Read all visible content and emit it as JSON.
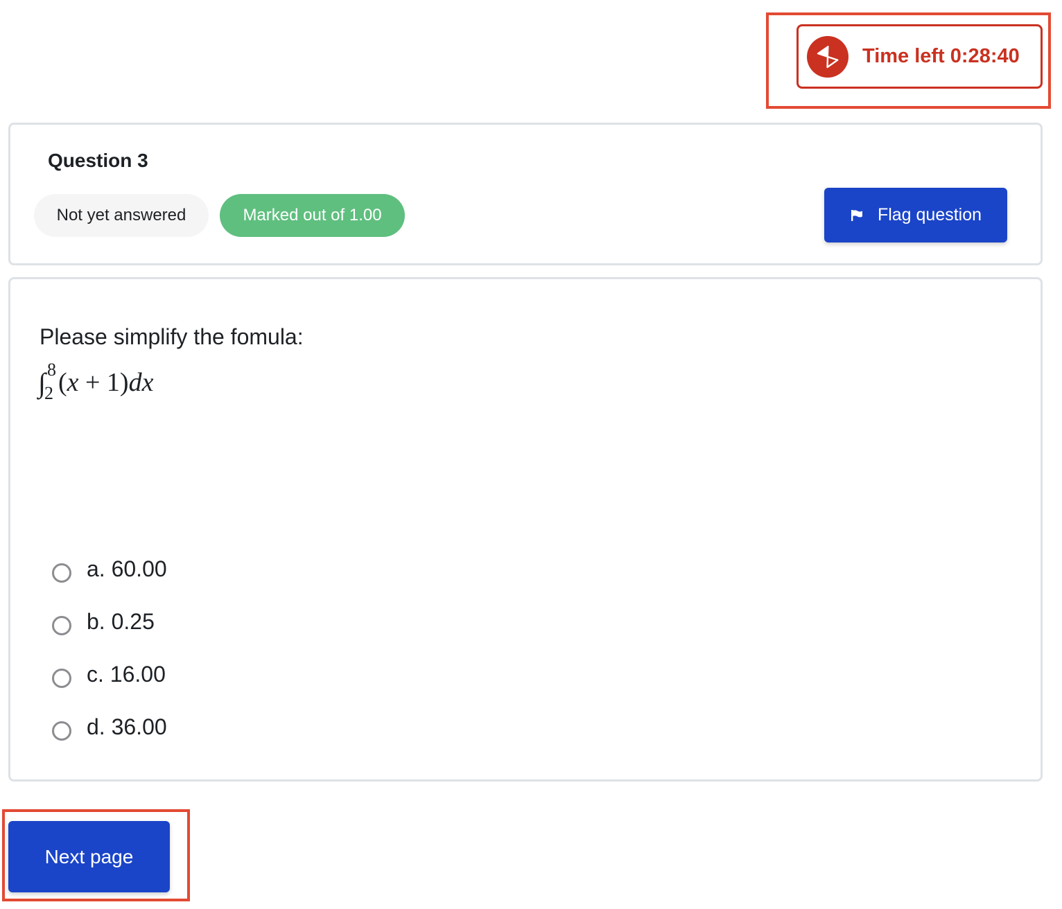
{
  "timer": {
    "label": "Time left 0:28:40",
    "icon": "hourglass-icon",
    "color": "#ca3120"
  },
  "question": {
    "title": "Question 3",
    "state": "Not yet answered",
    "grade": "Marked out of 1.00",
    "flag_label": "Flag question",
    "flag_icon": "flag-icon",
    "prompt": "Please simplify the fomula:",
    "formula": {
      "integral_sign": "∫",
      "upper_limit": "8",
      "lower_limit": "2",
      "open": "(",
      "x": "x",
      "plus_one": " + 1)",
      "d": "d",
      "dx_var": "x"
    },
    "answers": [
      {
        "label": "a. 60.00"
      },
      {
        "label": "b. 0.25"
      },
      {
        "label": "c. 16.00"
      },
      {
        "label": "d. 36.00"
      }
    ]
  },
  "navigation": {
    "next_label": "Next page"
  },
  "colors": {
    "primary": "#1b45c8",
    "success": "#5fbf7f",
    "danger": "#ca3120",
    "highlight": "#e34a33"
  }
}
